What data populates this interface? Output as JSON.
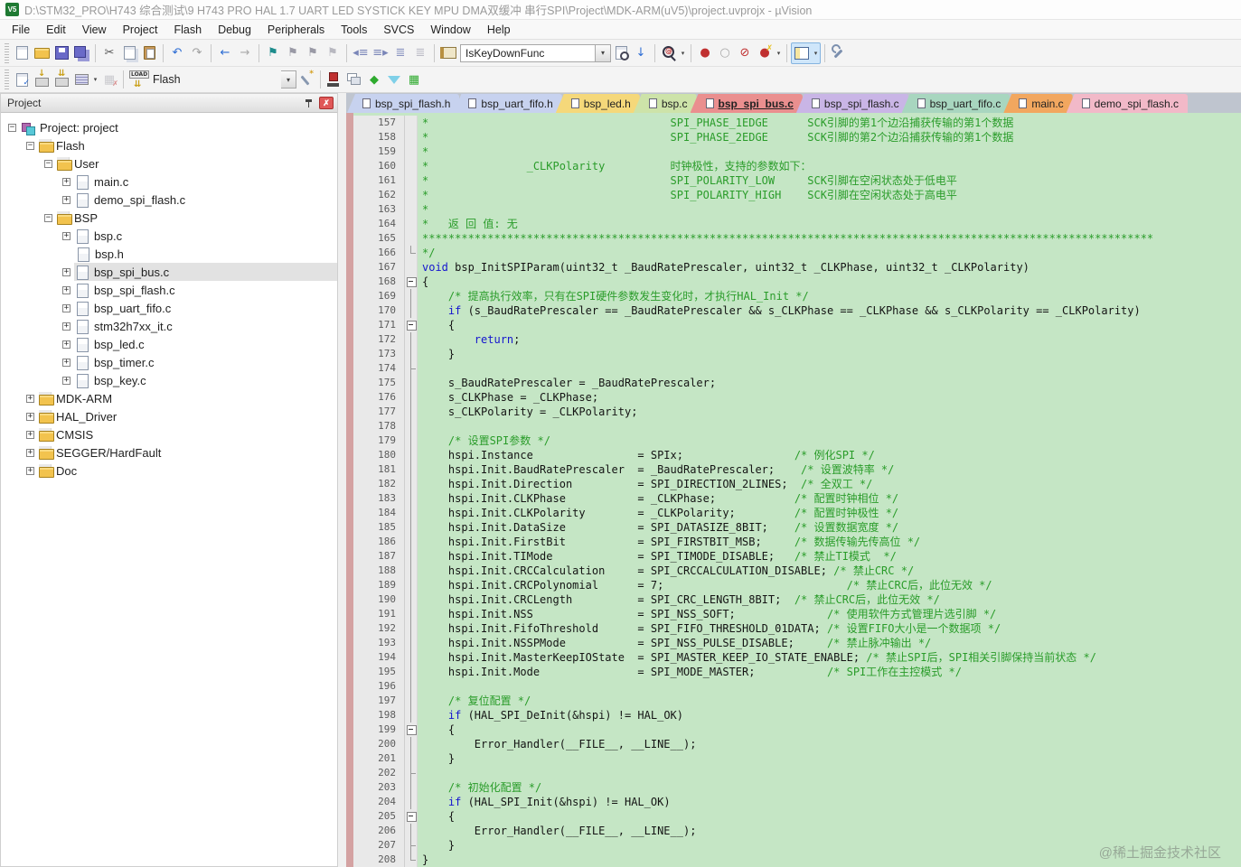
{
  "title_bar": {
    "app_icon": "uvision-logo-icon",
    "title": "D:\\STM32_PRO\\H743 综合测试\\9 H743 PRO HAL 1.7 UART LED SYSTICK KEY MPU DMA双缓冲 串行SPI\\Project\\MDK-ARM(uV5)\\project.uvprojx - µVision"
  },
  "menu": [
    "File",
    "Edit",
    "View",
    "Project",
    "Flash",
    "Debug",
    "Peripherals",
    "Tools",
    "SVCS",
    "Window",
    "Help"
  ],
  "toolbar_main": {
    "function_combo_value": "IsKeyDownFunc",
    "items": [
      {
        "n": "new-file-icon",
        "k": "pg"
      },
      {
        "n": "open-file-icon",
        "k": "folder"
      },
      {
        "n": "save-icon",
        "k": "disk"
      },
      {
        "n": "save-all-icon",
        "k": "disk2"
      },
      {
        "sep": 1
      },
      {
        "n": "cut-icon",
        "k": "ti",
        "g": "✂",
        "c": "#555555"
      },
      {
        "n": "copy-icon",
        "k": "pg2"
      },
      {
        "n": "paste-icon",
        "k": "clip"
      },
      {
        "sep": 1
      },
      {
        "n": "undo-icon",
        "k": "ti",
        "g": "↶",
        "c": "#2c6cd4"
      },
      {
        "n": "redo-icon",
        "k": "ti",
        "g": "↷",
        "c": "#a0a0a0"
      },
      {
        "sep": 1
      },
      {
        "n": "navigate-back-icon",
        "k": "ti",
        "g": "←",
        "c": "#2c6cd4"
      },
      {
        "n": "navigate-forward-icon",
        "k": "ti",
        "g": "→",
        "c": "#a8a8a8"
      },
      {
        "sep": 1
      },
      {
        "n": "bookmark-toggle-icon",
        "k": "ti",
        "g": "⚑",
        "c": "#1e8c8c"
      },
      {
        "n": "bookmark-prev-icon",
        "k": "ti",
        "g": "⚑",
        "c": "#9a9aa6"
      },
      {
        "n": "bookmark-next-icon",
        "k": "ti",
        "g": "⚑",
        "c": "#9a9aa6"
      },
      {
        "n": "bookmark-clear-icon",
        "k": "ti",
        "g": "⚑",
        "c": "#b8b8c0"
      },
      {
        "sep": 1
      },
      {
        "n": "outdent-icon",
        "k": "ti",
        "g": "◂≡",
        "c": "#7a86b8"
      },
      {
        "n": "indent-icon",
        "k": "ti",
        "g": "≡▸",
        "c": "#7a86b8"
      },
      {
        "n": "comment-selection-icon",
        "k": "ti",
        "g": "≣",
        "c": "#8a94c0"
      },
      {
        "n": "uncomment-selection-icon",
        "k": "ti",
        "g": "≣",
        "c": "#bcbcc6"
      },
      {
        "sep": 1
      },
      {
        "n": "function-list-icon",
        "k": "book"
      },
      {
        "combo": 1
      },
      {
        "n": "find-in-files-icon",
        "k": "pgmag"
      },
      {
        "n": "jump-to-reference-icon",
        "k": "ti",
        "g": "↓",
        "c": "#2c6cd4"
      },
      {
        "sep": 1
      },
      {
        "n": "find-symbol-icon",
        "k": "mag",
        "g": "@",
        "c": "#c03030",
        "caret": 1
      },
      {
        "sep": 1
      },
      {
        "n": "breakpoint-insert-icon",
        "k": "ti",
        "g": "●",
        "c": "#c03030"
      },
      {
        "n": "breakpoint-enable-icon",
        "k": "ti",
        "g": "○",
        "c": "#a8a8a8"
      },
      {
        "n": "breakpoint-disable-all-icon",
        "k": "ti",
        "g": "⊘",
        "c": "#c03030"
      },
      {
        "n": "breakpoint-kill-all-icon",
        "k": "bpkill",
        "g": "✗",
        "c": "#e8c020",
        "caret": 1
      },
      {
        "sep": 1
      },
      {
        "n": "window-layout-icon",
        "k": "winlay",
        "active": 1,
        "caret": 1
      },
      {
        "sep": 1
      },
      {
        "n": "configuration-wrench-icon",
        "k": "wrench"
      }
    ]
  },
  "toolbar_build": {
    "target_combo_value": "Flash",
    "items": [
      {
        "n": "translate-icon",
        "k": "pgchk",
        "g": "✓",
        "c": "#2c6cd4"
      },
      {
        "n": "build-icon",
        "k": "build",
        "g": "↓",
        "c": "#caa018"
      },
      {
        "n": "rebuild-all-icon",
        "k": "rebuild",
        "g": "⇊",
        "c": "#caa018"
      },
      {
        "n": "batch-build-icon",
        "k": "batch",
        "caret": 1
      },
      {
        "n": "stop-build-icon",
        "k": "stopb",
        "g": "✗",
        "c": "#c03030"
      },
      {
        "sep": 1
      },
      {
        "n": "download-flash-icon",
        "k": "load",
        "g": "⇊",
        "c": "#caa018"
      },
      {
        "tcombo": 1
      },
      {
        "n": "target-options-icon",
        "k": "wand",
        "g": "*",
        "c": "#d4a020"
      },
      {
        "sep": 1
      },
      {
        "n": "manage-rte-icon",
        "k": "rte"
      },
      {
        "n": "window-cascade-icon",
        "k": "wincasc"
      },
      {
        "n": "project-diamond-icon",
        "k": "ti",
        "g": "◆",
        "c": "#2eaa2e"
      },
      {
        "n": "filter-funnel-icon",
        "k": "funnel"
      },
      {
        "n": "books-icon",
        "k": "ti",
        "g": "▦",
        "c": "#2eaa2e"
      }
    ]
  },
  "project_panel": {
    "title": "Project",
    "tree": [
      {
        "d": 0,
        "exp": "-",
        "icon": "root",
        "label": "Project: project"
      },
      {
        "d": 1,
        "exp": "-",
        "icon": "fold",
        "label": "Flash"
      },
      {
        "d": 2,
        "exp": "-",
        "icon": "fold",
        "label": "User"
      },
      {
        "d": 3,
        "exp": "+",
        "icon": "file",
        "label": "main.c"
      },
      {
        "d": 3,
        "exp": "+",
        "icon": "file",
        "label": "demo_spi_flash.c"
      },
      {
        "d": 2,
        "exp": "-",
        "icon": "fold",
        "label": "BSP"
      },
      {
        "d": 3,
        "exp": "+",
        "icon": "file",
        "label": "bsp.c"
      },
      {
        "d": 3,
        "exp": "",
        "icon": "file",
        "label": "bsp.h"
      },
      {
        "d": 3,
        "exp": "+",
        "icon": "file",
        "label": "bsp_spi_bus.c",
        "sel": true
      },
      {
        "d": 3,
        "exp": "+",
        "icon": "file",
        "label": "bsp_spi_flash.c"
      },
      {
        "d": 3,
        "exp": "+",
        "icon": "file",
        "label": "bsp_uart_fifo.c"
      },
      {
        "d": 3,
        "exp": "+",
        "icon": "file",
        "label": "stm32h7xx_it.c"
      },
      {
        "d": 3,
        "exp": "+",
        "icon": "file",
        "label": "bsp_led.c"
      },
      {
        "d": 3,
        "exp": "+",
        "icon": "file",
        "label": "bsp_timer.c"
      },
      {
        "d": 3,
        "exp": "+",
        "icon": "file",
        "label": "bsp_key.c"
      },
      {
        "d": 1,
        "exp": "+",
        "icon": "fold",
        "label": "MDK-ARM"
      },
      {
        "d": 1,
        "exp": "+",
        "icon": "fold",
        "label": "HAL_Driver"
      },
      {
        "d": 1,
        "exp": "+",
        "icon": "fold",
        "label": "CMSIS"
      },
      {
        "d": 1,
        "exp": "+",
        "icon": "fold",
        "label": "SEGGER/HardFault"
      },
      {
        "d": 1,
        "exp": "+",
        "icon": "fold",
        "label": "Doc"
      }
    ]
  },
  "tabs": [
    {
      "label": "bsp_spi_flash.h",
      "color": "#c7d2ef"
    },
    {
      "label": "bsp_uart_fifo.h",
      "color": "#c7d2ef"
    },
    {
      "label": "bsp_led.h",
      "color": "#f5d87a"
    },
    {
      "label": "bsp.c",
      "color": "#cde3a9"
    },
    {
      "label": "bsp_spi_bus.c",
      "color": "#ea8f8f",
      "active": true
    },
    {
      "label": "bsp_spi_flash.c",
      "color": "#c9b5e6"
    },
    {
      "label": "bsp_uart_fifo.c",
      "color": "#a8d6bf"
    },
    {
      "label": "main.c",
      "color": "#f2a75f"
    },
    {
      "label": "demo_spi_flash.c",
      "color": "#f2b9c8"
    }
  ],
  "editor": {
    "bg": "#c5e6c5",
    "comment_color": "#2a9c2a",
    "keyword_color": "#1515cf",
    "lines": [
      {
        "n": 157,
        "f": "",
        "s": [
          [
            "cm",
            "*                                     SPI_PHASE_1EDGE      SCK引脚的第1个边沿捕获传输的第1个数据"
          ]
        ]
      },
      {
        "n": 158,
        "f": "",
        "s": [
          [
            "cm",
            "*                                     SPI_PHASE_2EDGE      SCK引脚的第2个边沿捕获传输的第1个数据"
          ]
        ]
      },
      {
        "n": 159,
        "f": "",
        "s": [
          [
            "cm",
            "*"
          ]
        ]
      },
      {
        "n": 160,
        "f": "",
        "s": [
          [
            "cm",
            "*               _CLKPolarity          时钟极性，支持的参数如下："
          ]
        ]
      },
      {
        "n": 161,
        "f": "",
        "s": [
          [
            "cm",
            "*                                     SPI_POLARITY_LOW     SCK引脚在空闲状态处于低电平"
          ]
        ]
      },
      {
        "n": 162,
        "f": "",
        "s": [
          [
            "cm",
            "*                                     SPI_POLARITY_HIGH    SCK引脚在空闲状态处于高电平"
          ]
        ]
      },
      {
        "n": 163,
        "f": "",
        "s": [
          [
            "cm",
            "*"
          ]
        ]
      },
      {
        "n": 164,
        "f": "",
        "s": [
          [
            "cm",
            "*   返 回 值: 无"
          ]
        ]
      },
      {
        "n": 165,
        "f": "",
        "s": [
          [
            "cm",
            "****************************************************************************************************************"
          ]
        ]
      },
      {
        "n": 166,
        "f": "e",
        "s": [
          [
            "cm",
            "*/"
          ]
        ]
      },
      {
        "n": 167,
        "f": "",
        "s": [
          [
            "kw",
            "void"
          ],
          [
            "pl",
            " bsp_InitSPIParam(uint32_t _BaudRatePrescaler, uint32_t _CLKPhase, uint32_t _CLKPolarity)"
          ]
        ]
      },
      {
        "n": 168,
        "f": "b",
        "s": [
          [
            "pl",
            "{"
          ]
        ]
      },
      {
        "n": 169,
        "f": "l",
        "s": [
          [
            "pl",
            "    "
          ],
          [
            "cm",
            "/* 提高执行效率，只有在SPI硬件参数发生变化时，才执行HAL_Init */"
          ]
        ]
      },
      {
        "n": 170,
        "f": "l",
        "s": [
          [
            "pl",
            "    "
          ],
          [
            "kw",
            "if"
          ],
          [
            "pl",
            " (s_BaudRatePrescaler == _BaudRatePrescaler && s_CLKPhase == _CLKPhase && s_CLKPolarity == _CLKPolarity)"
          ]
        ]
      },
      {
        "n": 171,
        "f": "b",
        "s": [
          [
            "pl",
            "    {"
          ]
        ]
      },
      {
        "n": 172,
        "f": "l",
        "s": [
          [
            "pl",
            "        "
          ],
          [
            "kw",
            "return"
          ],
          [
            "pl",
            ";"
          ]
        ]
      },
      {
        "n": 173,
        "f": "l",
        "s": [
          [
            "pl",
            "    }"
          ]
        ]
      },
      {
        "n": 174,
        "f": "t",
        "s": []
      },
      {
        "n": 175,
        "f": "l",
        "s": [
          [
            "pl",
            "    s_BaudRatePrescaler = _BaudRatePrescaler;"
          ]
        ]
      },
      {
        "n": 176,
        "f": "l",
        "s": [
          [
            "pl",
            "    s_CLKPhase = _CLKPhase;"
          ]
        ]
      },
      {
        "n": 177,
        "f": "l",
        "s": [
          [
            "pl",
            "    s_CLKPolarity = _CLKPolarity;"
          ]
        ]
      },
      {
        "n": 178,
        "f": "l",
        "s": []
      },
      {
        "n": 179,
        "f": "l",
        "s": [
          [
            "pl",
            "    "
          ],
          [
            "cm",
            "/* 设置SPI参数 */"
          ]
        ]
      },
      {
        "n": 180,
        "f": "l",
        "s": [
          [
            "pl",
            "    hspi.Instance                = SPIx;                 "
          ],
          [
            "cm",
            "/* 例化SPI */"
          ]
        ]
      },
      {
        "n": 181,
        "f": "l",
        "s": [
          [
            "pl",
            "    hspi.Init.BaudRatePrescaler  = _BaudRatePrescaler;    "
          ],
          [
            "cm",
            "/* 设置波特率 */"
          ]
        ]
      },
      {
        "n": 182,
        "f": "l",
        "s": [
          [
            "pl",
            "    hspi.Init.Direction          = SPI_DIRECTION_2LINES;  "
          ],
          [
            "cm",
            "/* 全双工 */"
          ]
        ]
      },
      {
        "n": 183,
        "f": "l",
        "s": [
          [
            "pl",
            "    hspi.Init.CLKPhase           = _CLKPhase;            "
          ],
          [
            "cm",
            "/* 配置时钟相位 */"
          ]
        ]
      },
      {
        "n": 184,
        "f": "l",
        "s": [
          [
            "pl",
            "    hspi.Init.CLKPolarity        = _CLKPolarity;         "
          ],
          [
            "cm",
            "/* 配置时钟极性 */"
          ]
        ]
      },
      {
        "n": 185,
        "f": "l",
        "s": [
          [
            "pl",
            "    hspi.Init.DataSize           = SPI_DATASIZE_8BIT;    "
          ],
          [
            "cm",
            "/* 设置数据宽度 */"
          ]
        ]
      },
      {
        "n": 186,
        "f": "l",
        "s": [
          [
            "pl",
            "    hspi.Init.FirstBit           = SPI_FIRSTBIT_MSB;     "
          ],
          [
            "cm",
            "/* 数据传输先传高位 */"
          ]
        ]
      },
      {
        "n": 187,
        "f": "l",
        "s": [
          [
            "pl",
            "    hspi.Init.TIMode             = SPI_TIMODE_DISABLE;   "
          ],
          [
            "cm",
            "/* 禁止TI模式  */"
          ]
        ]
      },
      {
        "n": 188,
        "f": "l",
        "s": [
          [
            "pl",
            "    hspi.Init.CRCCalculation     = SPI_CRCCALCULATION_DISABLE; "
          ],
          [
            "cm",
            "/* 禁止CRC */"
          ]
        ]
      },
      {
        "n": 189,
        "f": "l",
        "s": [
          [
            "pl",
            "    hspi.Init.CRCPolynomial      = 7;                            "
          ],
          [
            "cm",
            "/* 禁止CRC后，此位无效 */"
          ]
        ]
      },
      {
        "n": 190,
        "f": "l",
        "s": [
          [
            "pl",
            "    hspi.Init.CRCLength          = SPI_CRC_LENGTH_8BIT;  "
          ],
          [
            "cm",
            "/* 禁止CRC后，此位无效 */"
          ]
        ]
      },
      {
        "n": 191,
        "f": "l",
        "s": [
          [
            "pl",
            "    hspi.Init.NSS                = SPI_NSS_SOFT;              "
          ],
          [
            "cm",
            "/* 使用软件方式管理片选引脚 */"
          ]
        ]
      },
      {
        "n": 192,
        "f": "l",
        "s": [
          [
            "pl",
            "    hspi.Init.FifoThreshold      = SPI_FIFO_THRESHOLD_01DATA; "
          ],
          [
            "cm",
            "/* 设置FIFO大小是一个数据项 */"
          ]
        ]
      },
      {
        "n": 193,
        "f": "l",
        "s": [
          [
            "pl",
            "    hspi.Init.NSSPMode           = SPI_NSS_PULSE_DISABLE;     "
          ],
          [
            "cm",
            "/* 禁止脉冲输出 */"
          ]
        ]
      },
      {
        "n": 194,
        "f": "l",
        "s": [
          [
            "pl",
            "    hspi.Init.MasterKeepIOState  = SPI_MASTER_KEEP_IO_STATE_ENABLE; "
          ],
          [
            "cm",
            "/* 禁止SPI后，SPI相关引脚保持当前状态 */"
          ]
        ]
      },
      {
        "n": 195,
        "f": "l",
        "s": [
          [
            "pl",
            "    hspi.Init.Mode               = SPI_MODE_MASTER;           "
          ],
          [
            "cm",
            "/* SPI工作在主控模式 */"
          ]
        ]
      },
      {
        "n": 196,
        "f": "l",
        "s": []
      },
      {
        "n": 197,
        "f": "l",
        "s": [
          [
            "pl",
            "    "
          ],
          [
            "cm",
            "/* 复位配置 */"
          ]
        ]
      },
      {
        "n": 198,
        "f": "l",
        "s": [
          [
            "pl",
            "    "
          ],
          [
            "kw",
            "if"
          ],
          [
            "pl",
            " (HAL_SPI_DeInit(&hspi) != HAL_OK)"
          ]
        ]
      },
      {
        "n": 199,
        "f": "b",
        "s": [
          [
            "pl",
            "    {"
          ]
        ]
      },
      {
        "n": 200,
        "f": "l",
        "s": [
          [
            "pl",
            "        Error_Handler(__FILE__, __LINE__);"
          ]
        ]
      },
      {
        "n": 201,
        "f": "l",
        "s": [
          [
            "pl",
            "    }"
          ]
        ]
      },
      {
        "n": 202,
        "f": "t",
        "s": []
      },
      {
        "n": 203,
        "f": "l",
        "s": [
          [
            "pl",
            "    "
          ],
          [
            "cm",
            "/* 初始化配置 */"
          ]
        ]
      },
      {
        "n": 204,
        "f": "l",
        "s": [
          [
            "pl",
            "    "
          ],
          [
            "kw",
            "if"
          ],
          [
            "pl",
            " (HAL_SPI_Init(&hspi) != HAL_OK)"
          ]
        ]
      },
      {
        "n": 205,
        "f": "b",
        "s": [
          [
            "pl",
            "    {"
          ]
        ]
      },
      {
        "n": 206,
        "f": "l",
        "s": [
          [
            "pl",
            "        Error_Handler(__FILE__, __LINE__);"
          ]
        ]
      },
      {
        "n": 207,
        "f": "t",
        "s": [
          [
            "pl",
            "    }"
          ]
        ]
      },
      {
        "n": 208,
        "f": "e",
        "s": [
          [
            "pl",
            "}"
          ]
        ]
      }
    ]
  },
  "watermark": "@稀土掘金技术社区",
  "colors": {
    "editor_bg": "#c5e6c5",
    "gutter_bg": "#e9e9e9",
    "pink_strip": "#d4a2a2",
    "active_tab": "#ea8f8f",
    "selection_gray": "#e2e2e2"
  }
}
